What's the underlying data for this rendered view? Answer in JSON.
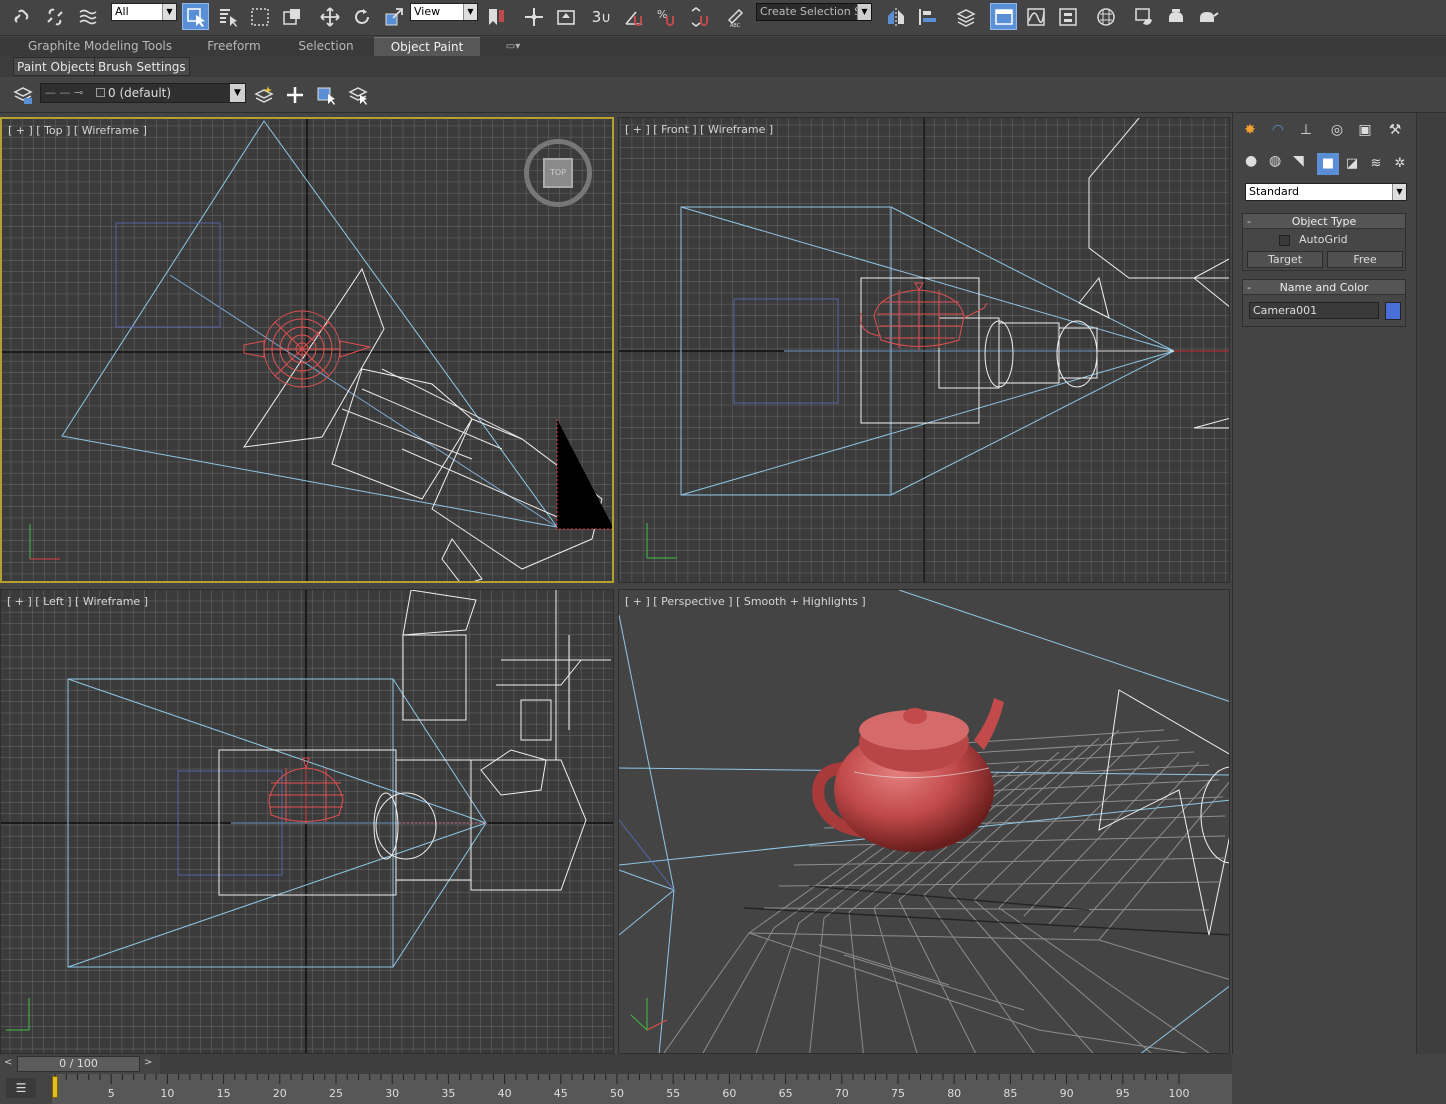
{
  "toolbar": {
    "selection_filter": "All",
    "ref_coord": "View",
    "named_selection_placeholder": "Create Selection Se",
    "snap_label": "3"
  },
  "ribbon": {
    "tabs": [
      {
        "label": "Graphite Modeling Tools"
      },
      {
        "label": "Freeform"
      },
      {
        "label": "Selection"
      },
      {
        "label": "Object Paint",
        "active": true
      }
    ],
    "subtabs": [
      "Paint Objects",
      "Brush Settings"
    ]
  },
  "layer_row": {
    "layer_name": "0 (default)"
  },
  "viewports": {
    "top": {
      "label": "[ + ] [ Top ] [ Wireframe ]",
      "viewcube": "TOP"
    },
    "front": {
      "label": "[ + ] [ Front ] [ Wireframe ]"
    },
    "left": {
      "label": "[ + ] [ Left ] [ Wireframe ]"
    },
    "perspective": {
      "label": "[ + ] [ Perspective ] [ Smooth + Highlights ]"
    }
  },
  "command_panel": {
    "category_dropdown": "Standard",
    "object_type": {
      "title": "Object Type",
      "autogrid": "AutoGrid",
      "buttons": [
        "Target",
        "Free"
      ]
    },
    "name_and_color": {
      "title": "Name and Color",
      "name_value": "Camera001",
      "color": "#4a6fd8"
    }
  },
  "timeline": {
    "frame_display": "0 / 100",
    "ticks": [
      "5",
      "10",
      "15",
      "20",
      "25",
      "30",
      "35",
      "40",
      "45",
      "50",
      "55",
      "60",
      "65",
      "70",
      "75",
      "80",
      "85",
      "90",
      "95",
      "100"
    ]
  },
  "colors": {
    "teapot": "#c24a4a",
    "camera_cone": "#8ec6e6",
    "selected_border": "#b5a030",
    "highlight": "#5a8fd6"
  }
}
